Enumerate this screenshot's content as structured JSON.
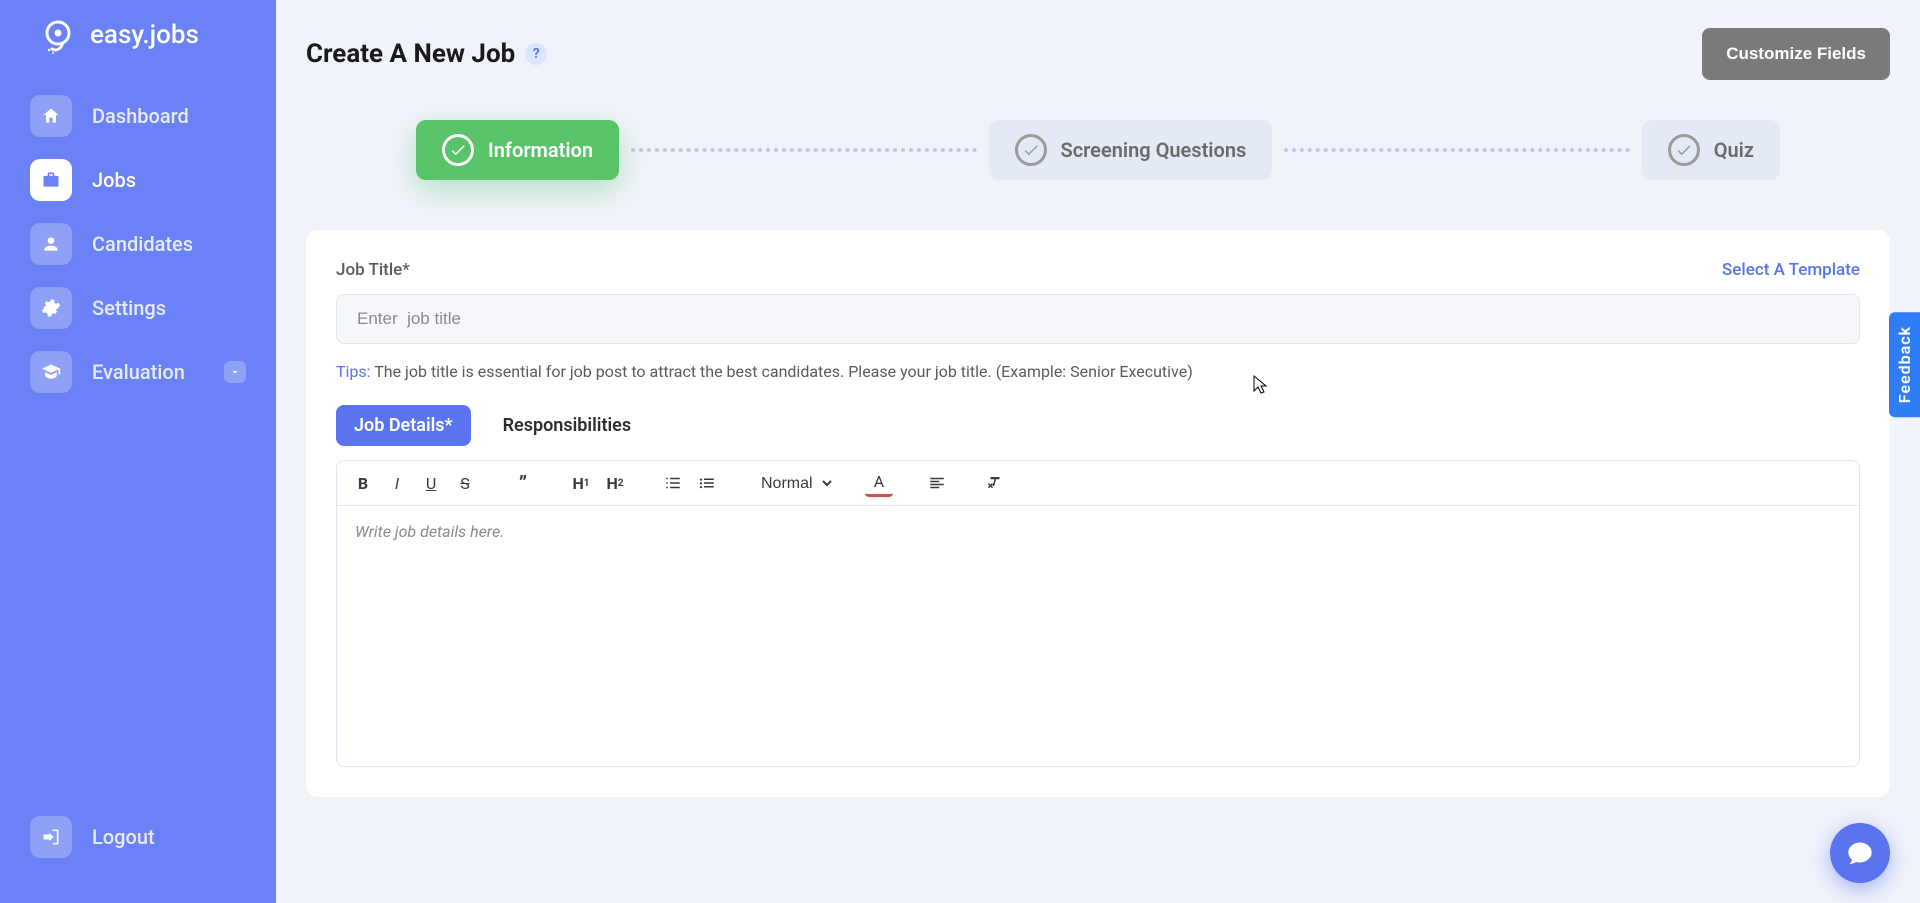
{
  "brand": {
    "name": "easy.jobs"
  },
  "sidebar": {
    "items": [
      {
        "label": "Dashboard",
        "icon": "home"
      },
      {
        "label": "Jobs",
        "icon": "briefcase",
        "active": true
      },
      {
        "label": "Candidates",
        "icon": "user"
      },
      {
        "label": "Settings",
        "icon": "gear"
      },
      {
        "label": "Evaluation",
        "icon": "graduation",
        "expandable": true
      }
    ],
    "logout_label": "Logout"
  },
  "header": {
    "title": "Create A New Job",
    "customize_button": "Customize Fields"
  },
  "stepper": {
    "steps": [
      {
        "label": "Information",
        "active": true
      },
      {
        "label": "Screening Questions",
        "active": false
      },
      {
        "label": "Quiz",
        "active": false
      }
    ]
  },
  "form": {
    "job_title_label": "Job Title*",
    "template_link": "Select A Template",
    "job_title_placeholder": "Enter  job title",
    "tips_label": "Tips:",
    "tips_text": " The job title is essential for job post to attract the best candidates. Please your job title. (Example: Senior Executive)",
    "tabs": [
      {
        "label": "Job Details*",
        "active": true
      },
      {
        "label": "Responsibilities",
        "active": false
      }
    ],
    "toolbar": {
      "size_select": "Normal"
    },
    "editor_placeholder": "Write job details here."
  },
  "feedback_label": "Feedback",
  "colors": {
    "sidebar": "#6a82f5",
    "accent": "#5a74f0",
    "step_active": "#59c36a"
  }
}
